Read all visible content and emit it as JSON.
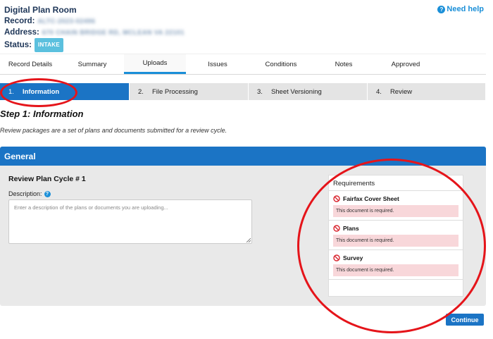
{
  "header": {
    "app_title": "Digital Plan Room",
    "record_label": "Record:",
    "record_value": "ALTC-2023-02496",
    "address_label": "Address:",
    "address_value": "670 CHAIN BRIDGE RD, MCLEAN VA 22101",
    "status_label": "Status:",
    "status_value": "INTAKE",
    "help_link": "Need help"
  },
  "tabs": [
    {
      "label": "Record Details"
    },
    {
      "label": "Summary"
    },
    {
      "label": "Uploads",
      "active": true
    },
    {
      "label": "Issues"
    },
    {
      "label": "Conditions"
    },
    {
      "label": "Notes"
    },
    {
      "label": "Approved"
    }
  ],
  "steps": [
    {
      "num": "1.",
      "label": "Information",
      "active": true
    },
    {
      "num": "2.",
      "label": "File Processing"
    },
    {
      "num": "3.",
      "label": "Sheet Versioning"
    },
    {
      "num": "4.",
      "label": "Review"
    }
  ],
  "step_heading": "Step 1: Information",
  "step_description": "Review packages are a set of plans and documents submitted for a review cycle.",
  "general": {
    "title": "General",
    "cycle_title": "Review Plan Cycle # 1",
    "description_label": "Description:",
    "description_placeholder": "Enter a description of the plans or documents you are uploading...",
    "description_value": ""
  },
  "requirements": {
    "title": "Requirements",
    "items": [
      {
        "name": "Fairfax Cover Sheet",
        "message": "This document is required."
      },
      {
        "name": "Plans",
        "message": "This document is required."
      },
      {
        "name": "Survey",
        "message": "This document is required."
      }
    ]
  },
  "continue_label": "Continue",
  "colors": {
    "primary": "#1b74c5",
    "link": "#1a8fd8",
    "badge": "#5bc0de",
    "error_bg": "#f8d7da",
    "annotation": "#e5141a"
  }
}
